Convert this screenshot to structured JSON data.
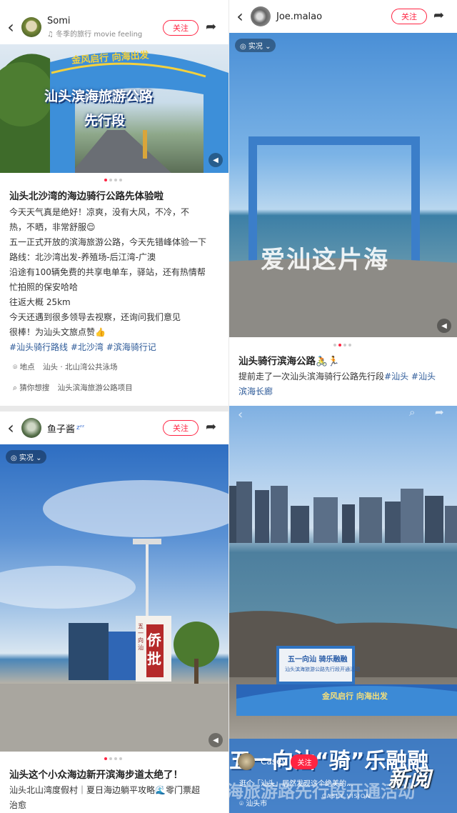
{
  "panel1": {
    "username": "Somi",
    "music": "♫ 冬季的旅行 movie feeling",
    "follow": "关注",
    "arch_text": "金风启行 向海出发",
    "overlay1": "汕头滨海旅游公路",
    "overlay2": "先行段",
    "title": "汕头北沙湾的海边骑行公路先体验啦",
    "lines": [
      "今天天气真是绝好！凉爽，没有大风，不冷，不",
      "热，不晒，非常舒服😌",
      "五一正式开放的滨海旅游公路，今天先错峰体验一下",
      "路线：北沙湾出发-养殖场-后江湾-广澳",
      "沿途有100辆免费的共享电单车，驿站，还有热情帮",
      "忙拍照的保安哈哈",
      "往返大概 25km",
      "今天还遇到很多领导去视察，还询问我们意见",
      "很棒！为汕头文旅点赞👍"
    ],
    "tags": "#汕头骑行路线 #北沙湾 #滨海骑行记",
    "location_label": "地点",
    "location": "汕头 · 北山湾公共泳场",
    "guess_label": "猜你想搜",
    "guess": "汕头滨海旅游公路项目"
  },
  "panel2": {
    "username": "Joe.malao",
    "follow": "关注",
    "chip": "◎ 实况 ⌄",
    "overlay": "爱汕这片海",
    "title": "汕头骑行滨海公路🚴🏃",
    "desc_line1": "提前走了一次汕头滨海骑行公路先行段",
    "desc_tags1": "#汕头 #汕头",
    "desc_tags2": "滨海长廊"
  },
  "panel3": {
    "username": "鱼子酱",
    "follow": "关注",
    "chip": "◎ 实况 ⌄",
    "sign1": "侨",
    "sign2": "批",
    "sign_small": "五一向汕",
    "title": "汕头这个小众海边新开滨海步道太绝了！",
    "line1": "汕头北山湾度假村｜夏日海边躺平攻略🌊零门票超",
    "line2": "治愈"
  },
  "panel4": {
    "banner_title": "五一向汕 骑乐融融",
    "banner_sub": "汕头滨海旅游公路先行段开通活动",
    "banner_bottom": "金风启行 向海出发",
    "big_text": "五一向汕“骑”乐融融",
    "big_text2": "海旅游路先行段开通活动",
    "username": "Casey",
    "follow": "关注",
    "caption": "逛个「汕头」居然发现这个绝美的...",
    "location": "汕头市",
    "watermark": "CASEY VISION",
    "logo": "新阅"
  },
  "colors": {
    "accent": "#ff2442",
    "tag": "#2d5a98"
  }
}
